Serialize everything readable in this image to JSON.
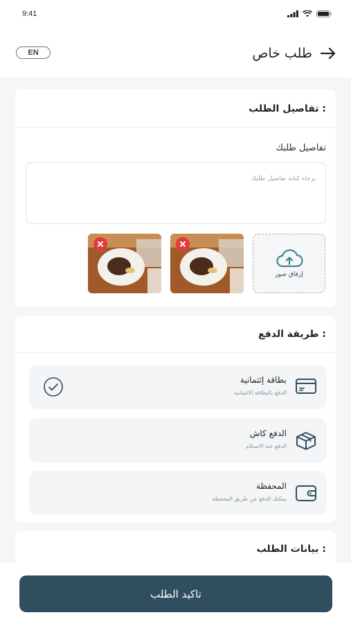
{
  "status_bar": {
    "time": "9:41"
  },
  "header": {
    "title": "طلب خاص",
    "lang_label": "EN"
  },
  "order_details": {
    "section_title": ": تفاصيل الطلب",
    "field_label": "تفاصيل طلبك",
    "placeholder": "برجاء كتابة تفاصيل طلبك",
    "upload_label": "إرفاق صور"
  },
  "payment": {
    "section_title": ": طريقة الدفع",
    "options": [
      {
        "title": "بطاقة إئتمانية",
        "subtitle": "الدفع بالبطاقة الائتمانية",
        "icon": "credit-card-icon",
        "selected": true
      },
      {
        "title": "الدفع كاش",
        "subtitle": "الدفع عند الاستلام",
        "icon": "cash-box-icon",
        "selected": false
      },
      {
        "title": "المحفظة",
        "subtitle": "يمكنك الدفع عن طريق المحفظة",
        "icon": "wallet-icon",
        "selected": false
      }
    ]
  },
  "order_data": {
    "section_title": ": بيانات الطلب"
  },
  "footer": {
    "confirm_label": "تاكيد الطلب"
  },
  "colors": {
    "primary": "#2f4f5f",
    "remove": "#e23b3b",
    "background": "#f5f6f7"
  }
}
